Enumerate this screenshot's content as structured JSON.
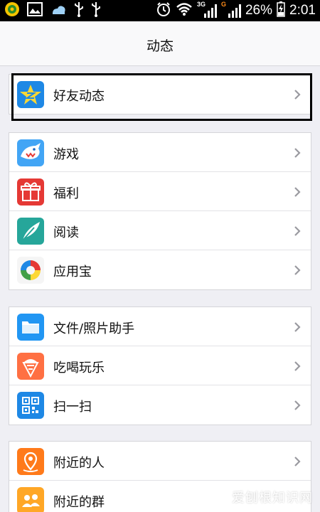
{
  "status_bar": {
    "network_3g": "3G",
    "network_g": "G",
    "battery": "26%",
    "time": "2:01"
  },
  "header": {
    "title": "动态"
  },
  "groups": [
    {
      "items": [
        {
          "label": "好友动态",
          "icon": "qzone-star-icon"
        }
      ]
    },
    {
      "items": [
        {
          "label": "游戏",
          "icon": "shark-game-icon"
        },
        {
          "label": "福利",
          "icon": "gift-icon"
        },
        {
          "label": "阅读",
          "icon": "feather-icon"
        },
        {
          "label": "应用宝",
          "icon": "app-store-icon"
        }
      ]
    },
    {
      "items": [
        {
          "label": "文件/照片助手",
          "icon": "folder-icon"
        },
        {
          "label": "吃喝玩乐",
          "icon": "ice-cream-icon"
        },
        {
          "label": "扫一扫",
          "icon": "qr-scan-icon"
        }
      ]
    },
    {
      "items": [
        {
          "label": "附近的人",
          "icon": "location-person-icon"
        },
        {
          "label": "附近的群",
          "icon": "location-group-icon"
        }
      ]
    }
  ],
  "watermark": "爱刨根知识网",
  "colors": {
    "status_bar_bg": "#000000",
    "page_bg": "#efeff4",
    "chevron": "#9a9aa0"
  }
}
